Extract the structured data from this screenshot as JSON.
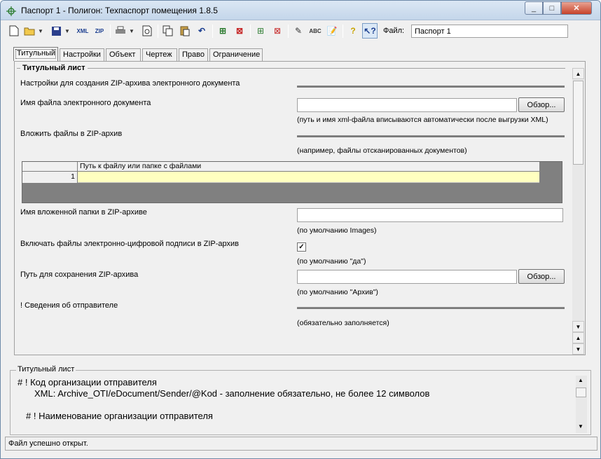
{
  "window": {
    "title": "Паспорт 1 - Полигон: Техпаспорт помещения 1.8.5",
    "minimize": "_",
    "maximize": "□",
    "close": "✕"
  },
  "toolbar": {
    "file_label": "Файл:",
    "file_value": "Паспорт 1",
    "xml_label": "XML",
    "zip_label": "ZIP",
    "abc_label": "ABC"
  },
  "tabs": [
    "Титульный",
    "Настройки",
    "Объект",
    "Чертеж",
    "Право",
    "Ограничение"
  ],
  "section": {
    "title": "Титульный лист",
    "zip_settings_label": "Настройки для создания ZIP-архива электронного документа",
    "doc_file_label": "Имя файла электронного документа",
    "browse_label": "Обзор...",
    "doc_file_hint": "(путь и имя xml-файла вписываются автоматически после выгрузки XML)",
    "attach_label": "Вложить файлы в ZIP-архив",
    "attach_hint": "(например, файлы отсканированных документов)",
    "grid_header": "Путь к файлу или папке с файлами",
    "grid_row_num": "1",
    "folder_label": "Имя вложенной папки в ZIP-архиве",
    "folder_hint": "(по умолчанию Images)",
    "signature_label": "Включать файлы электронно-цифровой подписи в ZIP-архив",
    "signature_checked": true,
    "signature_hint": "(по умолчанию \"да\")",
    "save_path_label": "Путь для сохранения ZIP-архива",
    "save_path_hint": "(по умолчанию \"Архив\")",
    "sender_label": "! Сведения об отправителе",
    "sender_hint": "(обязательно заполняется)"
  },
  "help_panel": {
    "title": "Титульный лист",
    "lines": [
      "# ! Код организации отправителя",
      "XML: Archive_OTI/eDocument/Sender/@Kod - заполнение обязательно, не более 12 символов",
      "# ! Наименование организации отправителя"
    ]
  },
  "status": "Файл успешно открыт."
}
